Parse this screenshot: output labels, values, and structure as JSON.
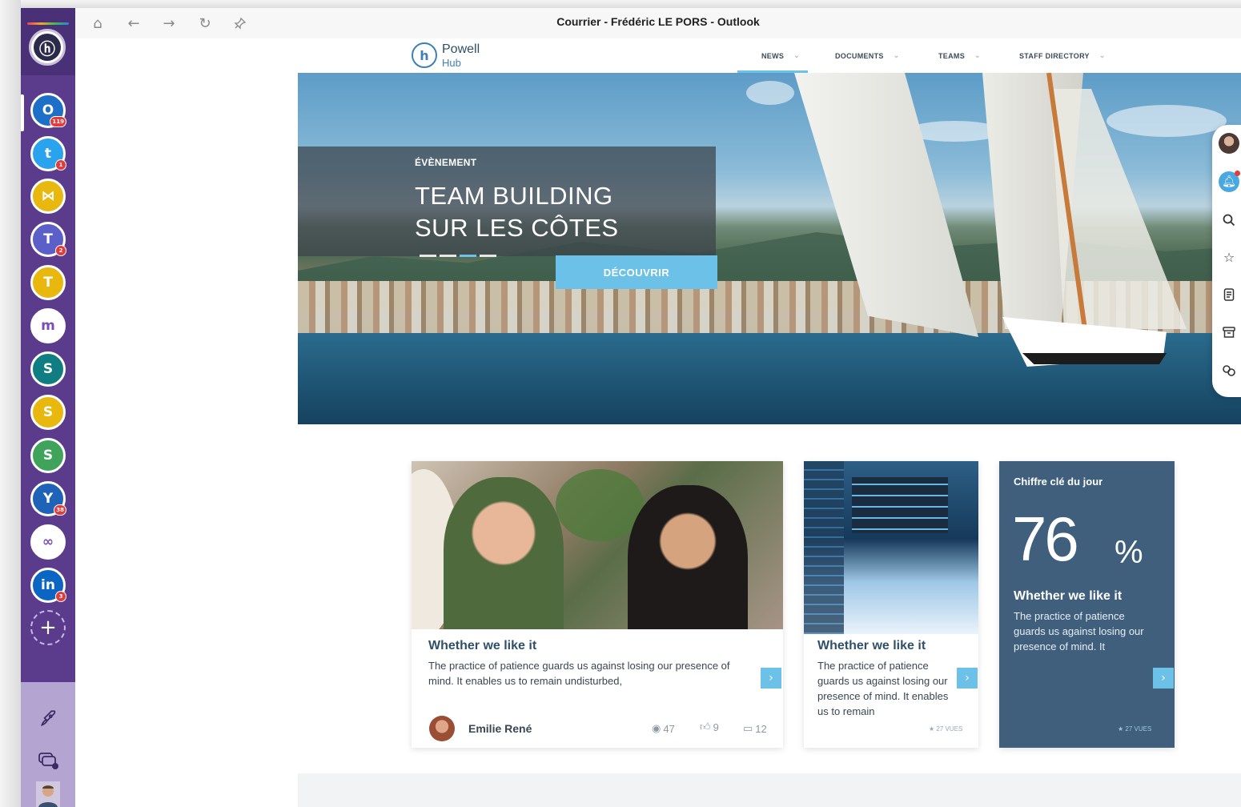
{
  "window": {
    "title": "Courrier - Frédéric LE PORS - Outlook"
  },
  "rail": {
    "apps": [
      {
        "name": "outlook",
        "glyph": "O",
        "color": "#1d6fc7",
        "badge": "119"
      },
      {
        "name": "twitter",
        "glyph": "t",
        "color": "#2aa3ef",
        "badge": "1"
      },
      {
        "name": "visual-studio",
        "glyph": "⋈",
        "color": "#e9b80f",
        "badge": ""
      },
      {
        "name": "teams",
        "glyph": "T",
        "color": "#5b5fc7",
        "badge": "2"
      },
      {
        "name": "teams-2",
        "glyph": "T",
        "color": "#e9b80f",
        "badge": ""
      },
      {
        "name": "powell-mail",
        "glyph": "m",
        "color": "#ffffff",
        "badge": ""
      },
      {
        "name": "sharepoint",
        "glyph": "S",
        "color": "#0f7d82",
        "badge": ""
      },
      {
        "name": "sharepoint-2",
        "glyph": "S",
        "color": "#e9b80f",
        "badge": ""
      },
      {
        "name": "sharepoint-3",
        "glyph": "S",
        "color": "#3fa35b",
        "badge": ""
      },
      {
        "name": "yammer",
        "glyph": "Y",
        "color": "#1f63b8",
        "badge": "38"
      },
      {
        "name": "link",
        "glyph": "∞",
        "color": "#ffffff",
        "badge": ""
      },
      {
        "name": "linkedin",
        "glyph": "in",
        "color": "#0a66c2",
        "badge": "3"
      }
    ],
    "add_label": "+"
  },
  "header": {
    "brand_name": "Powell",
    "brand_sub": "Hub",
    "menu": [
      "NEWS",
      "DOCUMENTS",
      "TEAMS",
      "STAFF DIRECTORY"
    ]
  },
  "hero": {
    "kicker": "ÉVÈNEMENT",
    "title_line1": "TEAM BUILDING",
    "title_line2": "SUR LES CÔTES",
    "cta": "DÉCOUVRIR"
  },
  "cards": {
    "news1": {
      "title": "Whether we like it",
      "text": "The practice of patience guards us against losing our presence of mind. It enables us to remain undisturbed,",
      "author": "Emilie René",
      "views": "47",
      "likes": "9",
      "comments": "12"
    },
    "news2": {
      "title": "Whether we like it",
      "text": "The practice of patience guards us against losing our presence of mind. It enables us to remain",
      "vues": "★ 27 VUES"
    },
    "stat": {
      "kicker": "Chiffre clé du jour",
      "value": "76",
      "unit": "%",
      "title": "Whether we like it",
      "text": "The practice of patience guards us against losing our presence of mind. It",
      "vues": "★ 27 VUES"
    }
  },
  "colors": {
    "rail": "#5a3b8c",
    "accent": "#6cc1e8",
    "stat_card": "#3f5f7c",
    "title": "#30506a"
  }
}
